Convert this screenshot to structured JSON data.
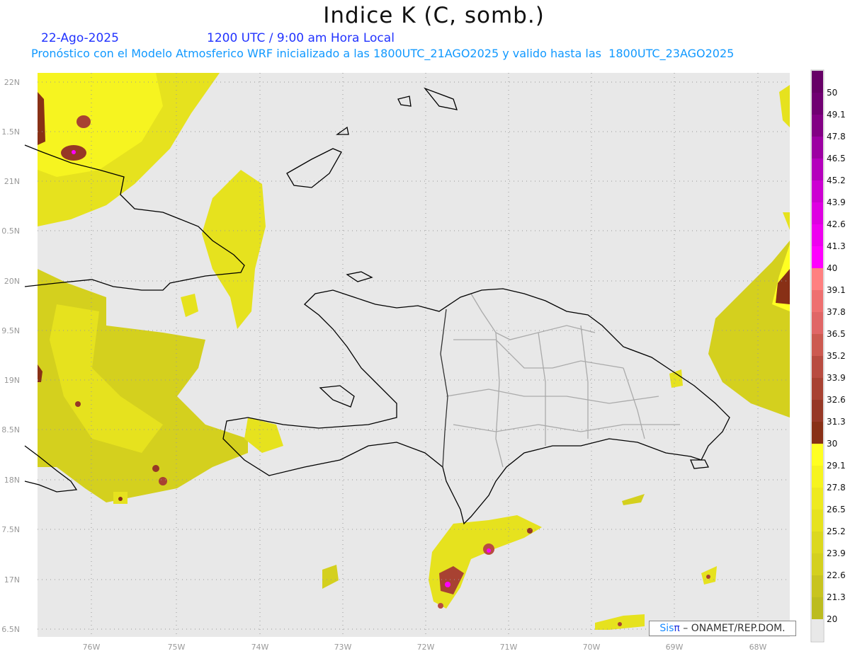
{
  "header": {
    "title": "Indice K (C, somb.)",
    "date": "22-Ago-2025",
    "time": "1200 UTC / 9:00 am Hora Local",
    "forecast": "Pronóstico con el Modelo Atmosferico WRF inicializado a las 1800UTC_21AGO2025 y valido hasta las  1800UTC_23AGO2025"
  },
  "axes": {
    "lon_labels": [
      "76W",
      "75W",
      "74W",
      "73W",
      "72W",
      "71W",
      "70W",
      "69W",
      "68W"
    ],
    "lat_labels": [
      "22N",
      "1.5N",
      "21N",
      "0.5N",
      "20N",
      "9.5N",
      "19N",
      "8.5N",
      "18N",
      "7.5N",
      "17N",
      "6.5N"
    ]
  },
  "colorbar": {
    "labels": [
      "50",
      "49.1",
      "47.8",
      "46.5",
      "45.2",
      "43.9",
      "42.6",
      "41.3",
      "40",
      "39.1",
      "37.8",
      "36.5",
      "35.2",
      "33.9",
      "32.6",
      "31.3",
      "30",
      "29.1",
      "27.8",
      "26.5",
      "25.2",
      "23.9",
      "22.6",
      "21.3",
      "20"
    ],
    "colors": [
      "#660066",
      "#700072",
      "#820084",
      "#9c00a2",
      "#b400bc",
      "#cc00d2",
      "#de00e2",
      "#ee00f0",
      "#ff00ff",
      "#ff8080",
      "#ee7070",
      "#e06666",
      "#cc5a50",
      "#b84c40",
      "#a84232",
      "#963826",
      "#883016",
      "#ffff22",
      "#f6f420",
      "#eeea20",
      "#e6e21e",
      "#dcd81e",
      "#d4d01e",
      "#c8c420",
      "#bcbc20",
      "#e8e8e8"
    ]
  },
  "credit": {
    "sis": "Sis",
    "pi": "π",
    "rest": " –  ONAMET/REP.DOM."
  },
  "colors": {
    "map_bg": "#e8e8e8",
    "yellow": "#e6e21e",
    "bright_yellow": "#ffff22",
    "brown": "#883016"
  }
}
